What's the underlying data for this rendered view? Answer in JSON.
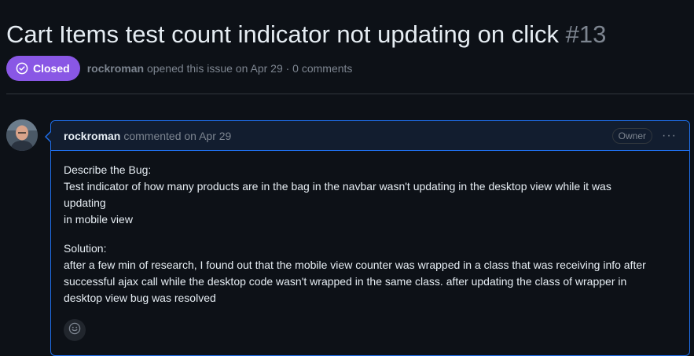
{
  "issue": {
    "title": "Cart Items test count indicator not updating on click",
    "number": "#13",
    "status": "Closed",
    "author": "rockroman",
    "opened_text": "opened this issue on Apr 29 · 0 comments"
  },
  "comment": {
    "author": "rockroman",
    "action": "commented on Apr 29",
    "role_badge": "Owner",
    "menu_label": "···",
    "body": {
      "line1": "Describe the Bug:",
      "line2": "Test indicator of how many products are in the bag in the navbar wasn't updating in the desktop view while it was",
      "line3": "updating",
      "line4": "in mobile view",
      "line5": "Solution:",
      "line6": "after a few min of research, I found out that the mobile view counter was wrapped in a class that was receiving info after",
      "line7": "successful ajax call while the desktop code wasn't wrapped in the same class. after updating the class of wrapper in",
      "line8": "desktop view bug was resolved"
    }
  },
  "colors": {
    "background": "#0d1117",
    "closed_badge": "#8957e5",
    "comment_border": "#1f6feb",
    "comment_header": "#121d2f",
    "muted_text": "#7d8590"
  },
  "icons": {
    "status": "check-circle-icon",
    "reaction": "smiley-icon"
  }
}
